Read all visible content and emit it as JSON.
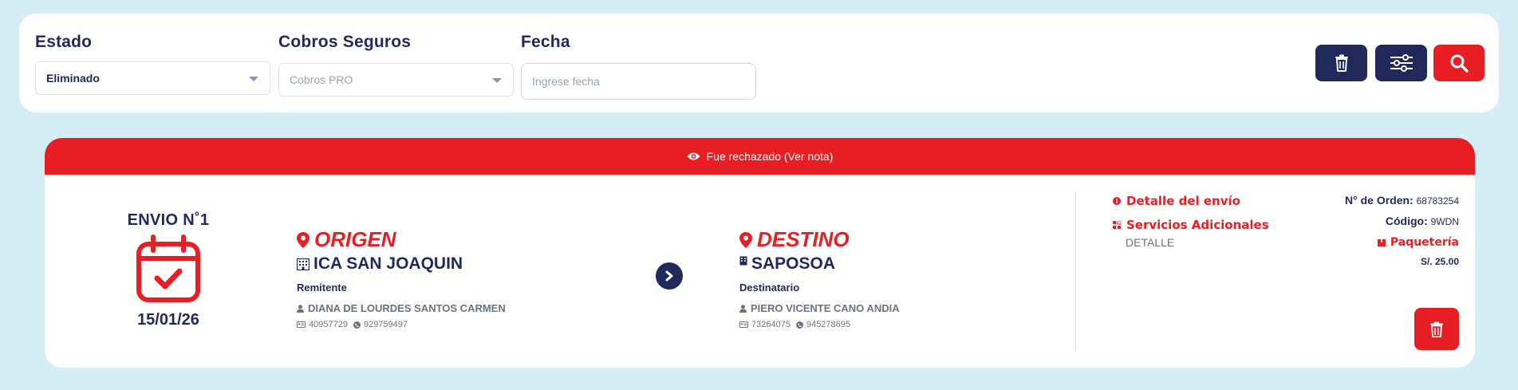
{
  "filters": {
    "estado": {
      "label": "Estado",
      "value": "Eliminado"
    },
    "cobros": {
      "label": "Cobros Seguros",
      "placeholder": "Cobros PRO"
    },
    "fecha": {
      "label": "Fecha",
      "placeholder": "Ingrese fecha"
    }
  },
  "toolbar": {
    "buttons": [
      {
        "icon": "trash-icon",
        "color": "#1f2a5a"
      },
      {
        "icon": "sliders-icon",
        "color": "#1f2a5a"
      },
      {
        "icon": "search-icon",
        "color": "#e81e25"
      }
    ]
  },
  "shipment": {
    "banner": "Fue rechazado (Ver nota)",
    "envio_title": "ENVIO N˚1",
    "date": "15/01/26",
    "origin": {
      "heading": "ORIGEN",
      "city": "ICA SAN JOAQUIN",
      "role": "Remitente",
      "name": "DIANA DE LOURDES SANTOS CARMEN",
      "doc": "40957729",
      "phone": "929759497"
    },
    "destination": {
      "heading": "DESTINO",
      "city": "SAPOSOA",
      "role": "Destinatario",
      "name": "PIERO VICENTE CANO ANDIA",
      "doc": "73264075",
      "phone": "945278695"
    },
    "details": {
      "detalle_envio": "Detalle del envío",
      "servicios": "Servicios Adicionales",
      "servicios_sub": "DETALLE",
      "orden_label": "N° de Orden:",
      "orden_value": "68783254",
      "codigo_label": "Código:",
      "codigo_value": "9WDN",
      "tipo": "Paquetería",
      "precio": "S/. 25.00"
    }
  },
  "colors": {
    "navy": "#1f2a5a",
    "red": "#e81e25",
    "background": "#d5eef6"
  }
}
